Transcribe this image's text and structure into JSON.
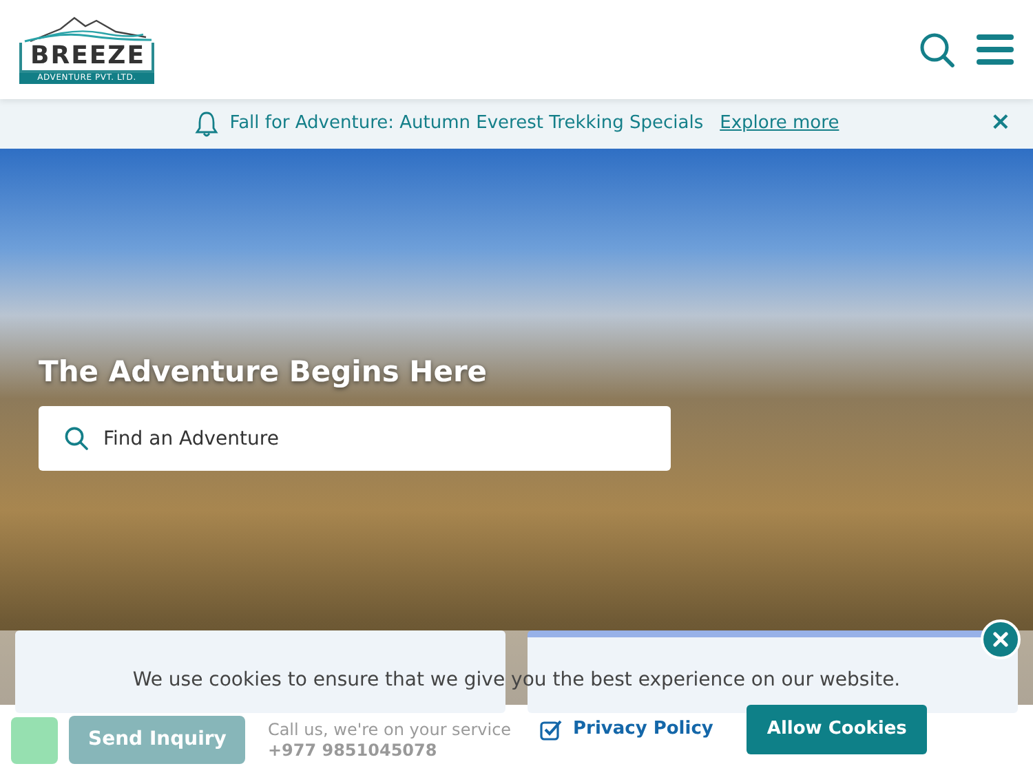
{
  "header": {
    "logo": {
      "name": "BREEZE",
      "tagline": "ADVENTURE PVT. LTD."
    }
  },
  "announcement": {
    "text": "Fall for Adventure: Autumn Everest Trekking Specials",
    "link": "Explore more",
    "close": "×"
  },
  "hero": {
    "heading": "The Adventure Begins Here",
    "search": {
      "placeholder": "Find an Adventure"
    }
  },
  "contact_bar": {
    "button": "Send Inquiry",
    "call_text": "Call us, we're on your service",
    "phone": "+977 9851045078"
  },
  "cookie_notice": {
    "message": "We use cookies to ensure that we give you the best experience on our website.",
    "policy_link": {
      "label": "Privacy Policy",
      "checked": true
    },
    "accept_button": "Allow Cookies"
  }
}
